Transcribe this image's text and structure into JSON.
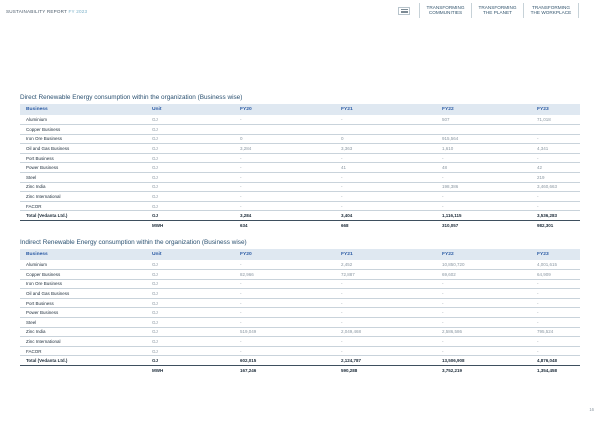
{
  "header": {
    "report_title": "SUSTAINABILITY REPORT",
    "report_year": "FY 2023",
    "nav": [
      {
        "line1": "TRANSFORMING",
        "line2": "COMMUNITIES"
      },
      {
        "line1": "TRANSFORMING",
        "line2": "THE PLANET"
      },
      {
        "line1": "TRANSFORMING",
        "line2": "THE WORKPLACE"
      }
    ]
  },
  "direct": {
    "title": "Direct Renewable Energy consumption within the organization (Business wise)",
    "headers": [
      "Business",
      "Unit",
      "FY20",
      "FY21",
      "FY22",
      "FY23"
    ],
    "rows": [
      [
        "Aluminium",
        "GJ",
        "-",
        "-",
        "507",
        "71,018"
      ],
      [
        "Copper Business",
        "GJ",
        "",
        "",
        "",
        ""
      ],
      [
        "Iron Ore Business",
        "GJ",
        "0",
        "0",
        "915,564",
        "-"
      ],
      [
        "Oil and Gas Business",
        "GJ",
        "3,284",
        "3,363",
        "1,610",
        "4,341"
      ],
      [
        "Port Business",
        "GJ",
        "-",
        "-",
        "-",
        "-"
      ],
      [
        "Power Business",
        "GJ",
        "-",
        "41",
        "48",
        "42"
      ],
      [
        "Steel",
        "GJ",
        "-",
        "-",
        "-",
        "219"
      ],
      [
        "Zinc India",
        "GJ",
        "-",
        "-",
        "198,386",
        "3,460,663"
      ],
      [
        "Zinc International",
        "GJ",
        "-",
        "-",
        "-",
        "-"
      ],
      [
        "FACOR",
        "GJ",
        "-",
        "-",
        "-",
        "-"
      ]
    ],
    "total": [
      "Total (Vedanta Ltd.)",
      "GJ",
      "3,284",
      "3,404",
      "1,116,115",
      "3,536,283"
    ],
    "mwh": [
      "",
      "MWH",
      "634",
      "668",
      "310,057",
      "982,301"
    ]
  },
  "indirect": {
    "title": "Indirect Renewable Energy consumption within the organization (Business wise)",
    "headers": [
      "Business",
      "Unit",
      "FY20",
      "FY21",
      "FY22",
      "FY23"
    ],
    "rows": [
      [
        "Aluminium",
        "GJ",
        "-",
        "2,452",
        "10,850,720",
        "4,001,615"
      ],
      [
        "Copper Business",
        "GJ",
        "82,966",
        "72,887",
        "69,602",
        "64,909"
      ],
      [
        "Iron Ore Business",
        "GJ",
        "-",
        "-",
        "-",
        "-"
      ],
      [
        "Oil and Gas Business",
        "GJ",
        "-",
        "-",
        "-",
        "-"
      ],
      [
        "Port Business",
        "GJ",
        "-",
        "-",
        "-",
        "-"
      ],
      [
        "Power Business",
        "GJ",
        "-",
        "-",
        "-",
        "-"
      ],
      [
        "Steel",
        "GJ",
        "-",
        "-",
        "-",
        "-"
      ],
      [
        "Zinc India",
        "GJ",
        "519,049",
        "2,049,468",
        "2,586,586",
        "795,524"
      ],
      [
        "Zinc International",
        "GJ",
        "-",
        "-",
        "-",
        "-"
      ],
      [
        "FACOR",
        "GJ",
        "-",
        "-",
        "-",
        "-"
      ]
    ],
    "total": [
      "Total (Vedanta Ltd.)",
      "GJ",
      "602,015",
      "2,124,787",
      "13,506,908",
      "4,876,048"
    ],
    "mwh": [
      "",
      "MWH",
      "167,246",
      "590,288",
      "3,752,219",
      "1,354,458"
    ]
  },
  "page_number": "16"
}
